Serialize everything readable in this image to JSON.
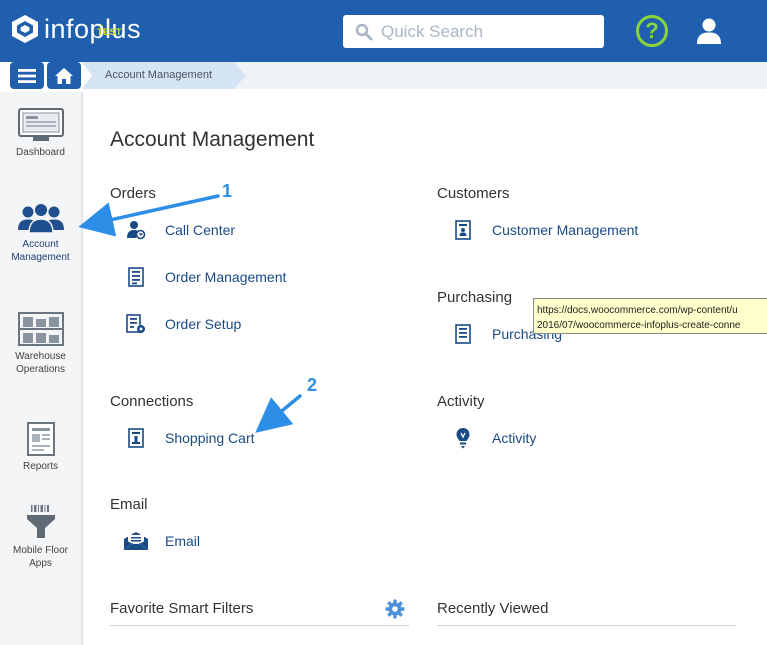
{
  "header": {
    "logo_text": "infoplus",
    "logo_badge": "TEST",
    "search_placeholder": "Quick Search",
    "help_label": "?"
  },
  "breadcrumb": {
    "current": "Account Management"
  },
  "sidebar": {
    "items": [
      {
        "label": "Dashboard"
      },
      {
        "label": "Account\nManagement"
      },
      {
        "label": "Warehouse\nOperations"
      },
      {
        "label": "Reports"
      },
      {
        "label": "Mobile Floor\nApps"
      }
    ]
  },
  "main": {
    "title": "Account Management",
    "sections": {
      "orders": {
        "title": "Orders",
        "links": [
          "Call Center",
          "Order Management",
          "Order Setup"
        ]
      },
      "customers": {
        "title": "Customers",
        "links": [
          "Customer Management"
        ]
      },
      "purchasing": {
        "title": "Purchasing",
        "links": [
          "Purchasing"
        ]
      },
      "connections": {
        "title": "Connections",
        "links": [
          "Shopping Cart"
        ]
      },
      "activity": {
        "title": "Activity",
        "links": [
          "Activity"
        ]
      },
      "email": {
        "title": "Email",
        "links": [
          "Email"
        ]
      },
      "favorite_filters": {
        "title": "Favorite Smart Filters"
      },
      "recently_viewed": {
        "title": "Recently Viewed"
      }
    }
  },
  "tooltip": {
    "line1": "https://docs.woocommerce.com/wp-content/u",
    "line2": "2016/07/woocommerce-infoplus-create-conne"
  },
  "annotations": {
    "marker1": "1",
    "marker2": "2"
  },
  "colors": {
    "brand_blue": "#1f5fae",
    "link_blue": "#1a4a86",
    "help_green": "#8bd43c",
    "annotation_blue": "#2d8ee8"
  }
}
